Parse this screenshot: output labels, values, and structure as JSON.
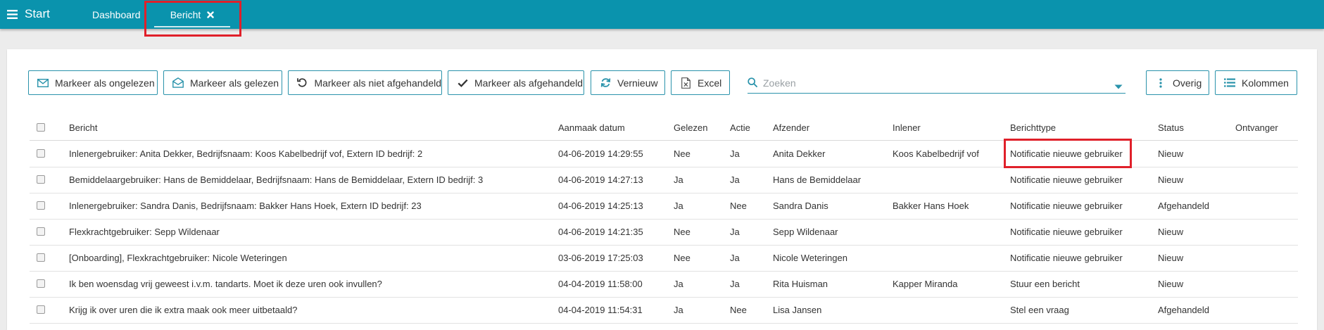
{
  "nav": {
    "menu_label": "Start",
    "tabs": [
      {
        "label": "Dashboard",
        "active": false
      },
      {
        "label": "Bericht",
        "active": true
      }
    ]
  },
  "toolbar": {
    "buttons": [
      {
        "label": "Markeer als ongelezen",
        "icon": "envelope-icon"
      },
      {
        "label": "Markeer als gelezen",
        "icon": "envelope-open-icon"
      },
      {
        "label": "Markeer als niet afgehandeld",
        "icon": "undo-icon"
      },
      {
        "label": "Markeer als afgehandeld",
        "icon": "check-icon"
      },
      {
        "label": "Vernieuw",
        "icon": "refresh-icon"
      },
      {
        "label": "Excel",
        "icon": "excel-file-icon"
      },
      {
        "label": "Overig",
        "icon": "vertical-ellipsis-icon"
      },
      {
        "label": "Kolommen",
        "icon": "list-icon"
      }
    ],
    "search": {
      "placeholder": "Zoeken",
      "value": ""
    }
  },
  "table": {
    "columns": [
      "Bericht",
      "Aanmaak datum",
      "Gelezen",
      "Actie",
      "Afzender",
      "Inlener",
      "Berichttype",
      "Status",
      "Ontvanger"
    ],
    "rows": [
      {
        "bericht": "Inlenergebruiker: Anita Dekker, Bedrijfsnaam: Koos Kabelbedrijf vof, Extern ID bedrijf: 2",
        "datum": "04-06-2019 14:29:55",
        "gelezen": "Nee",
        "actie": "Ja",
        "afzender": "Anita Dekker",
        "inlener": "Koos Kabelbedrijf vof",
        "berichttype": "Notificatie nieuwe gebruiker",
        "status": "Nieuw",
        "ontvanger": ""
      },
      {
        "bericht": "Bemiddelaargebruiker: Hans de Bemiddelaar, Bedrijfsnaam: Hans de Bemiddelaar, Extern ID bedrijf: 3",
        "datum": "04-06-2019 14:27:13",
        "gelezen": "Ja",
        "actie": "Ja",
        "afzender": "Hans de Bemiddelaar",
        "inlener": "",
        "berichttype": "Notificatie nieuwe gebruiker",
        "status": "Nieuw",
        "ontvanger": ""
      },
      {
        "bericht": "Inlenergebruiker: Sandra Danis, Bedrijfsnaam: Bakker Hans Hoek, Extern ID bedrijf: 23",
        "datum": "04-06-2019 14:25:13",
        "gelezen": "Ja",
        "actie": "Nee",
        "afzender": "Sandra Danis",
        "inlener": "Bakker Hans Hoek",
        "berichttype": "Notificatie nieuwe gebruiker",
        "status": "Afgehandeld",
        "ontvanger": ""
      },
      {
        "bericht": "Flexkrachtgebruiker: Sepp Wildenaar",
        "datum": "04-06-2019 14:21:35",
        "gelezen": "Nee",
        "actie": "Ja",
        "afzender": "Sepp Wildenaar",
        "inlener": "",
        "berichttype": "Notificatie nieuwe gebruiker",
        "status": "Nieuw",
        "ontvanger": ""
      },
      {
        "bericht": "[Onboarding], Flexkrachtgebruiker: Nicole Weteringen",
        "datum": "03-06-2019 17:25:03",
        "gelezen": "Nee",
        "actie": "Ja",
        "afzender": "Nicole Weteringen",
        "inlener": "",
        "berichttype": "Notificatie nieuwe gebruiker",
        "status": "Nieuw",
        "ontvanger": ""
      },
      {
        "bericht": "Ik ben woensdag vrij geweest i.v.m. tandarts. Moet ik deze uren ook invullen?",
        "datum": "04-04-2019 11:58:00",
        "gelezen": "Ja",
        "actie": "Ja",
        "afzender": "Rita Huisman",
        "inlener": "Kapper Miranda",
        "berichttype": "Stuur een bericht",
        "status": "Nieuw",
        "ontvanger": ""
      },
      {
        "bericht": "Krijg ik over uren die ik extra maak ook meer uitbetaald?",
        "datum": "04-04-2019 11:54:31",
        "gelezen": "Ja",
        "actie": "Nee",
        "afzender": "Lisa Jansen",
        "inlener": "",
        "berichttype": "Stel een vraag",
        "status": "Afgehandeld",
        "ontvanger": ""
      }
    ]
  },
  "colors": {
    "header": "#0a93ad",
    "accent": "#2a93ab",
    "highlight": "#e0202a",
    "actie_underline": "#e0607e"
  }
}
